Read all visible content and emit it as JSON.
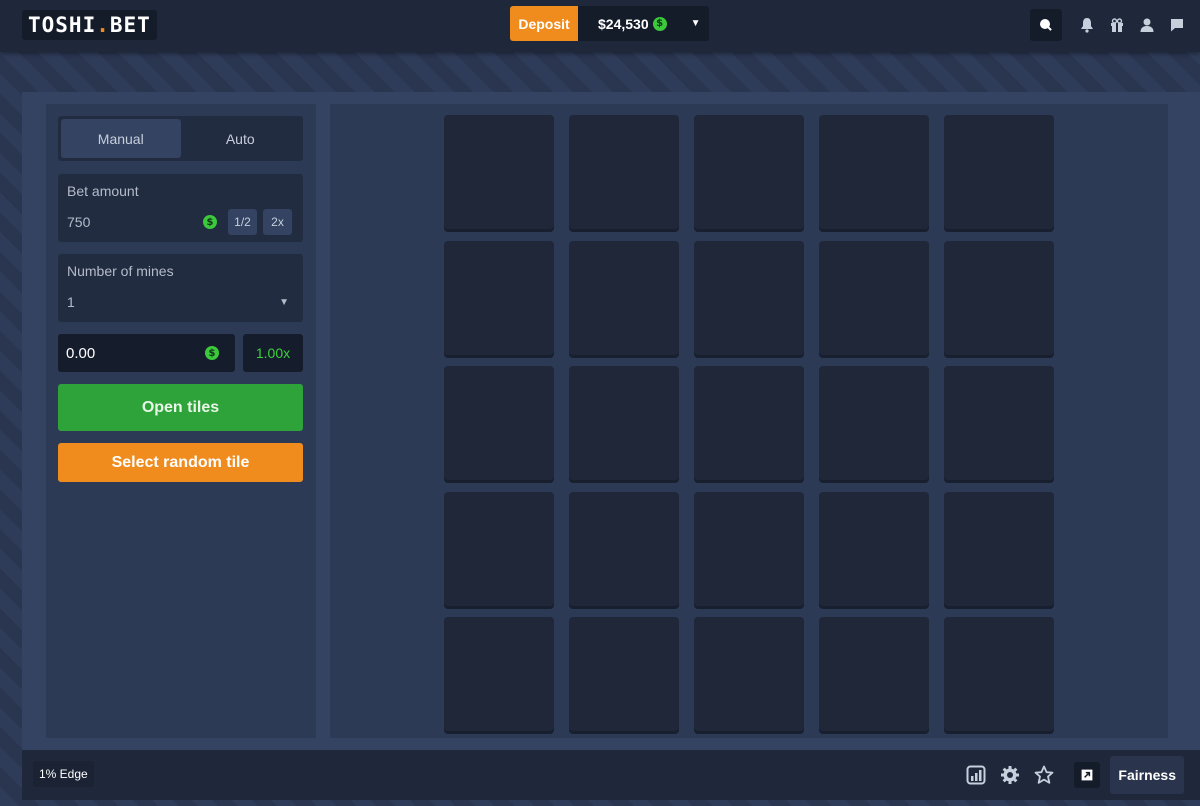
{
  "header": {
    "logo_text": "TOSHI",
    "logo_dot": ".",
    "logo_suffix": "BET",
    "deposit_label": "Deposit",
    "balance": "$24,530",
    "coin_symbol": "$",
    "icons": [
      "search-icon",
      "bell-icon",
      "gift-icon",
      "user-icon",
      "chat-icon"
    ]
  },
  "controls": {
    "tabs": [
      {
        "label": "Manual",
        "active": true
      },
      {
        "label": "Auto",
        "active": false
      }
    ],
    "bet_amount": {
      "label": "Bet amount",
      "value": "750",
      "half_label": "1/2",
      "double_label": "2x"
    },
    "mines": {
      "label": "Number of mines",
      "value": "1"
    },
    "profit_value": "0.00",
    "multiplier": "1.00x",
    "open_tiles_label": "Open tiles",
    "random_tile_label": "Select random tile"
  },
  "board": {
    "rows": 5,
    "cols": 5
  },
  "footer": {
    "edge_label": "1% Edge",
    "fairness_label": "Fairness",
    "icons": [
      "stats-icon",
      "settings-icon",
      "star-icon",
      "popout-icon"
    ]
  },
  "colors": {
    "accent_orange": "#f08c1e",
    "accent_green": "#2ea33a",
    "multiplier_green": "#3cd23c",
    "tile": "#1f2739"
  }
}
